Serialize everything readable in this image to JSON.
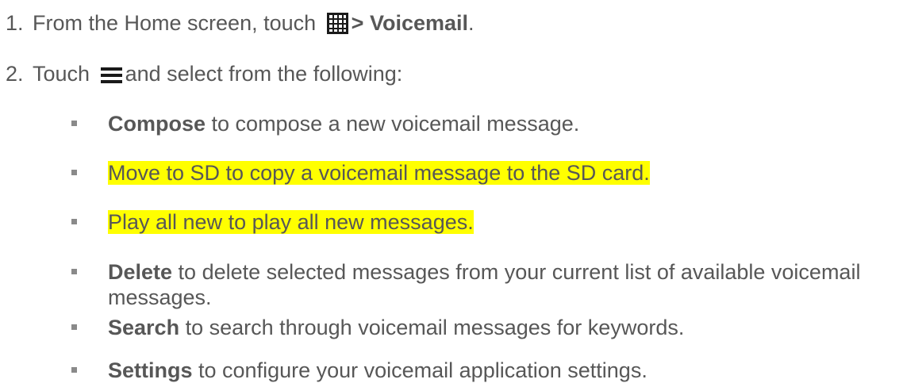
{
  "steps": [
    {
      "number": "1.",
      "text_before": "From the Home screen, touch",
      "icon": "apps-grid-icon",
      "text_after": "> Voicemail",
      "trailing": "."
    },
    {
      "number": "2.",
      "text_before": "Touch",
      "icon": "menu-icon",
      "text_after": "and select from the following:"
    }
  ],
  "options": [
    {
      "bold": "Compose",
      "text": " to compose a new voicemail message.",
      "highlighted": false
    },
    {
      "bold": "",
      "text": "Move to SD to copy a voicemail message to the SD card.",
      "highlighted": true
    },
    {
      "bold": "",
      "text": "Play all new to play all new messages.",
      "highlighted": true
    },
    {
      "bold": "Delete",
      "text": " to delete selected messages from your current list of available voicemail messages.",
      "highlighted": false
    },
    {
      "bold": "Search",
      "text": " to search through voicemail messages for keywords.",
      "highlighted": false
    },
    {
      "bold": "Settings",
      "text": " to configure your voicemail application settings.",
      "highlighted": false
    }
  ],
  "colors": {
    "text": "#575757",
    "highlight": "#ffff00",
    "bullet": "#8a8a8a"
  }
}
